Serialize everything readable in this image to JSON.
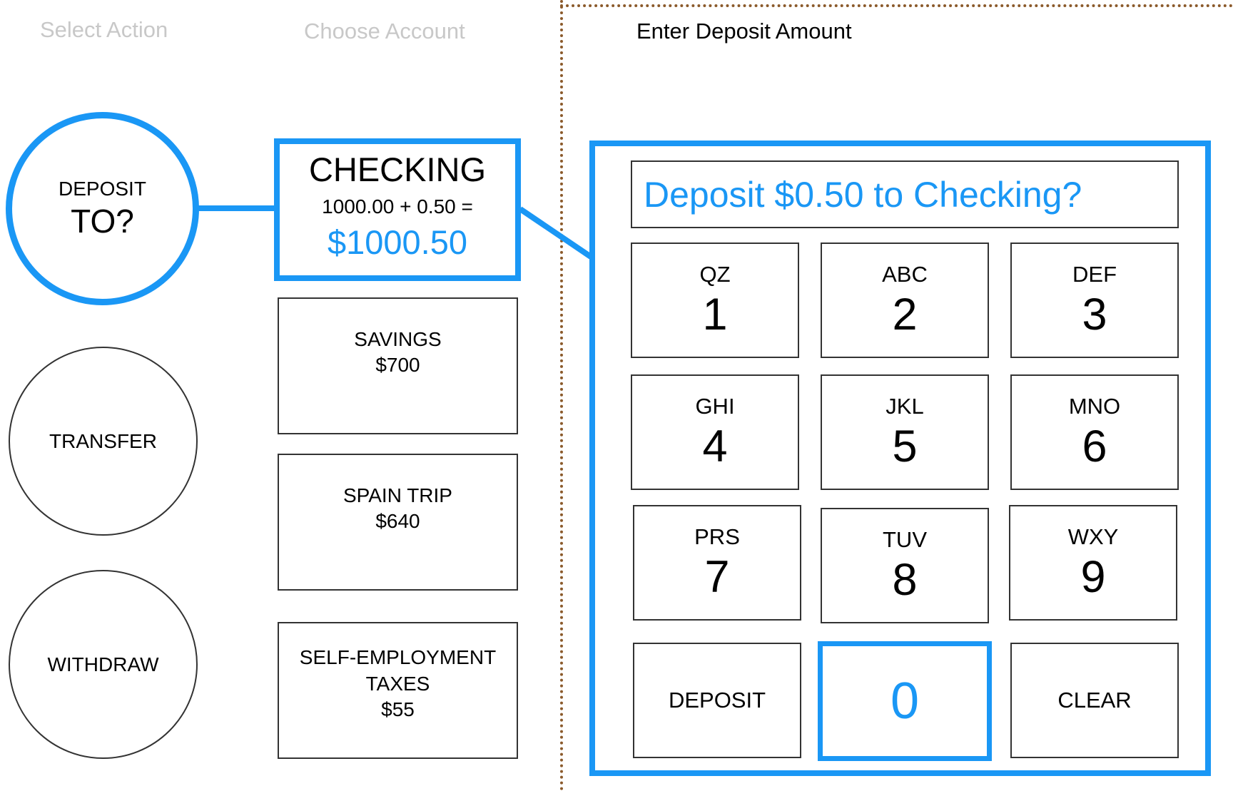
{
  "steps": {
    "select_action": "Select Action",
    "choose_account": "Choose Account",
    "enter_amount": "Enter Deposit Amount"
  },
  "actions": {
    "deposit": {
      "line1": "DEPOSIT",
      "line2": "TO?"
    },
    "transfer": {
      "label": "TRANSFER"
    },
    "withdraw": {
      "label": "WITHDRAW"
    }
  },
  "accounts": {
    "checking": {
      "name": "CHECKING",
      "calc": "1000.00 + 0.50 =",
      "result": "$1000.50"
    },
    "savings": {
      "name": "SAVINGS",
      "balance": "$700"
    },
    "spain_trip": {
      "name": "SPAIN TRIP",
      "balance": "$640"
    },
    "self_employment": {
      "name_line1": "SELF-EMPLOYMENT",
      "name_line2": "TAXES",
      "balance": "$55"
    }
  },
  "keypad": {
    "display": "Deposit $0.50 to Checking?",
    "keys": [
      {
        "letters": "QZ",
        "digit": "1"
      },
      {
        "letters": "ABC",
        "digit": "2"
      },
      {
        "letters": "DEF",
        "digit": "3"
      },
      {
        "letters": "GHI",
        "digit": "4"
      },
      {
        "letters": "JKL",
        "digit": "5"
      },
      {
        "letters": "MNO",
        "digit": "6"
      },
      {
        "letters": "PRS",
        "digit": "7"
      },
      {
        "letters": "TUV",
        "digit": "8"
      },
      {
        "letters": "WXY",
        "digit": "9"
      }
    ],
    "deposit_label": "DEPOSIT",
    "zero": "0",
    "clear_label": "CLEAR"
  },
  "colors": {
    "accent": "#1a97f5",
    "divider": "#8b5a2b",
    "dim_text": "#c8c8c8"
  }
}
